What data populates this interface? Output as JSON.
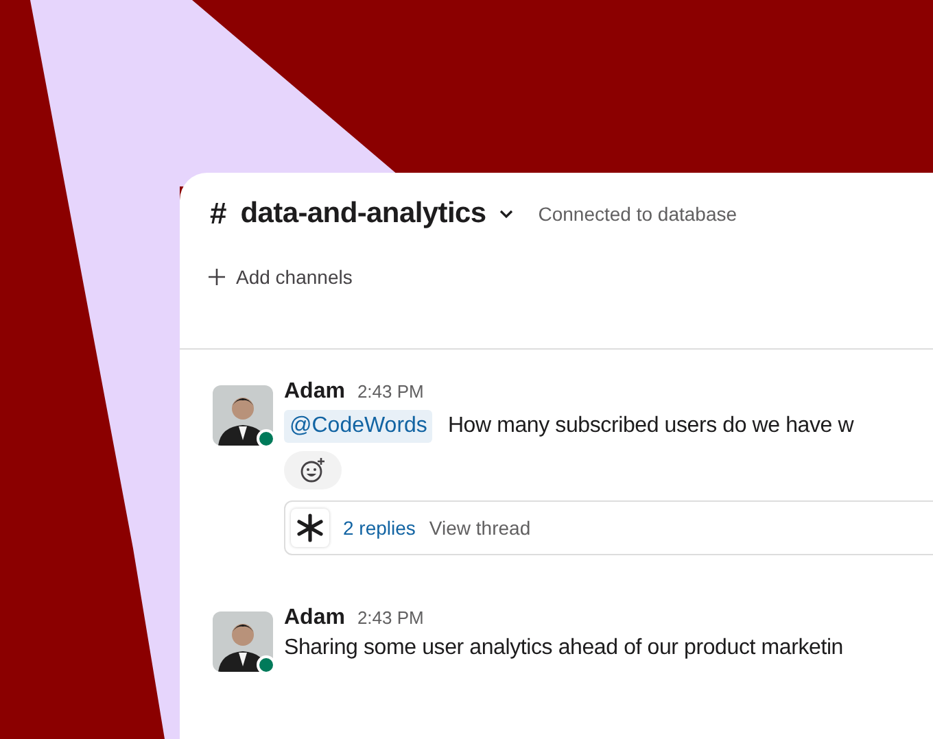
{
  "channel": {
    "hash": "#",
    "name": "data-and-analytics",
    "topic": "Connected to database",
    "add_channels": "Add channels"
  },
  "messages": [
    {
      "author": "Adam",
      "time": "2:43 PM",
      "online": true,
      "mention": "@CodeWords",
      "text": "How many subscribed users do we have w",
      "thread": {
        "replies": "2 replies",
        "view": "View thread"
      }
    },
    {
      "author": "Adam",
      "time": "2:43 PM",
      "online": true,
      "text": "Sharing some user analytics ahead of our product marketin"
    }
  ]
}
